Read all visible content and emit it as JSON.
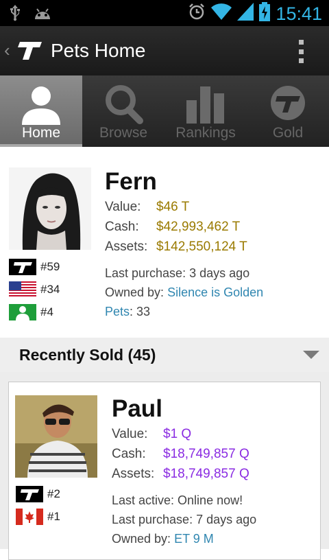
{
  "status_bar": {
    "time": "15:41",
    "icons": [
      "usb-icon",
      "android-debug-icon",
      "alarm-icon",
      "wifi-icon",
      "signal-icon",
      "battery-charging-icon"
    ]
  },
  "action_bar": {
    "title": "Pets Home",
    "logo_icon": "t-logo-icon",
    "back_icon": "back-chevron-icon",
    "menu_icon": "overflow-menu-icon"
  },
  "tabs": [
    {
      "label": "Home",
      "icon": "person-icon",
      "active": true
    },
    {
      "label": "Browse",
      "icon": "search-icon",
      "active": false
    },
    {
      "label": "Rankings",
      "icon": "bar-chart-icon",
      "active": false
    },
    {
      "label": "Gold",
      "icon": "t-coin-icon",
      "active": false
    }
  ],
  "profile": {
    "name": "Fern",
    "value_label": "Value:",
    "value": "$46 T",
    "cash_label": "Cash:",
    "cash": "$42,993,462 T",
    "assets_label": "Assets:",
    "assets": "$142,550,124 T",
    "last_purchase": "Last purchase: 3 days ago",
    "owned_by_label": "Owned by:",
    "owned_by": "Silence is Golden",
    "pets_label": "Pets",
    "pets_count": ": 33",
    "ranks": [
      {
        "icon": "t-logo-icon",
        "rank": "#59"
      },
      {
        "icon": "us-flag-icon",
        "rank": "#34"
      },
      {
        "icon": "person-badge-icon",
        "rank": "#4"
      }
    ]
  },
  "recently_sold": {
    "title": "Recently Sold (45)"
  },
  "pet_card": {
    "name": "Paul",
    "value_label": "Value:",
    "value": "$1 Q",
    "cash_label": "Cash:",
    "cash": "$18,749,857 Q",
    "assets_label": "Assets:",
    "assets": "$18,749,857 Q",
    "last_active": "Last active: Online now!",
    "last_purchase": "Last purchase: 7 days ago",
    "owned_by_label": "Owned by:",
    "owned_by": "ET 9 M",
    "ranks": [
      {
        "icon": "t-logo-icon",
        "rank": "#2"
      },
      {
        "icon": "canada-flag-icon",
        "rank": "#1"
      }
    ]
  },
  "colors": {
    "accent": "#33b5e5",
    "profile_values": "#9a7a00",
    "pet_values": "#8a2be2",
    "link": "#2f86b0"
  }
}
